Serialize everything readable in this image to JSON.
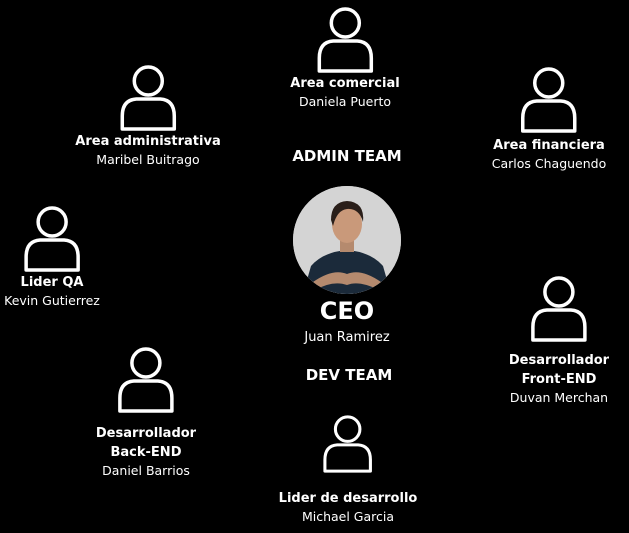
{
  "teams": {
    "admin": "ADMIN TEAM",
    "dev": "DEV TEAM"
  },
  "ceo": {
    "title": "CEO",
    "name": "Juan Ramirez"
  },
  "members": {
    "comercial": {
      "role": "Area comercial",
      "name": "Daniela Puerto"
    },
    "admin": {
      "role": "Area administrativa",
      "name": "Maribel Buitrago"
    },
    "financiera": {
      "role": "Area financiera",
      "name": "Carlos Chaguendo"
    },
    "qa": {
      "role": "Lider QA",
      "name": "Kevin Gutierrez"
    },
    "frontend": {
      "role": "Desarrollador\nFront-END",
      "name": "Duvan Merchan"
    },
    "backend": {
      "role": "Desarrollador\nBack-END",
      "name": "Daniel Barrios"
    },
    "liderdev": {
      "role": "Lider de desarrollo",
      "name": "Michael Garcia"
    }
  },
  "icon": "user-outline-icon"
}
